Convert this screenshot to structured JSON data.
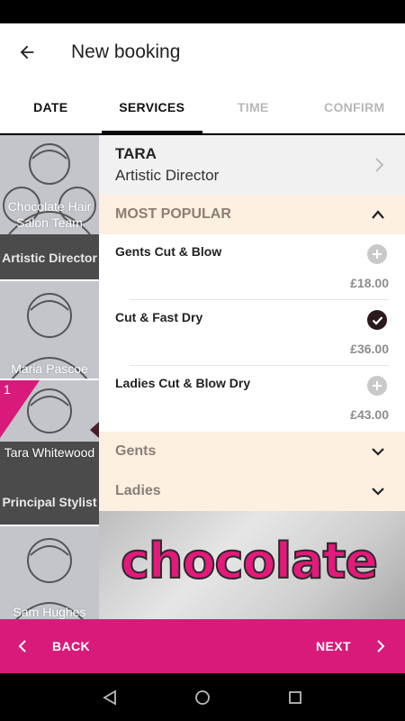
{
  "app_bar": {
    "title": "New booking"
  },
  "tabs": [
    {
      "label": "DATE"
    },
    {
      "label": "SERVICES"
    },
    {
      "label": "TIME"
    },
    {
      "label": "CONFIRM"
    }
  ],
  "stylists": [
    {
      "name": "Chocolate Hair Salon Team",
      "role": "Artistic Director"
    },
    {
      "name": "Maria Pascoe"
    },
    {
      "name": "Tara Whitewood",
      "role": "Principal Stylist",
      "badge": "1"
    },
    {
      "name": "Sam Hughes"
    }
  ],
  "selected_stylist": {
    "name": "TARA",
    "role": "Artistic Director"
  },
  "categories": {
    "popular": "MOST POPULAR",
    "gents": "Gents",
    "ladies": "Ladies"
  },
  "services": [
    {
      "name": "Gents Cut & Blow",
      "price": "£18.00",
      "selected": false
    },
    {
      "name": "Cut & Fast Dry",
      "price": "£36.00",
      "selected": true
    },
    {
      "name": "Ladies Cut & Blow Dry",
      "price": "£43.00",
      "selected": false
    }
  ],
  "brand": {
    "logo_text": "chocolate"
  },
  "bottom_bar": {
    "back_label": "BACK",
    "next_label": "NEXT"
  },
  "colors": {
    "accent": "#d81b7b",
    "category_bg": "#fdf0e1",
    "check": "#2a1a1a"
  }
}
